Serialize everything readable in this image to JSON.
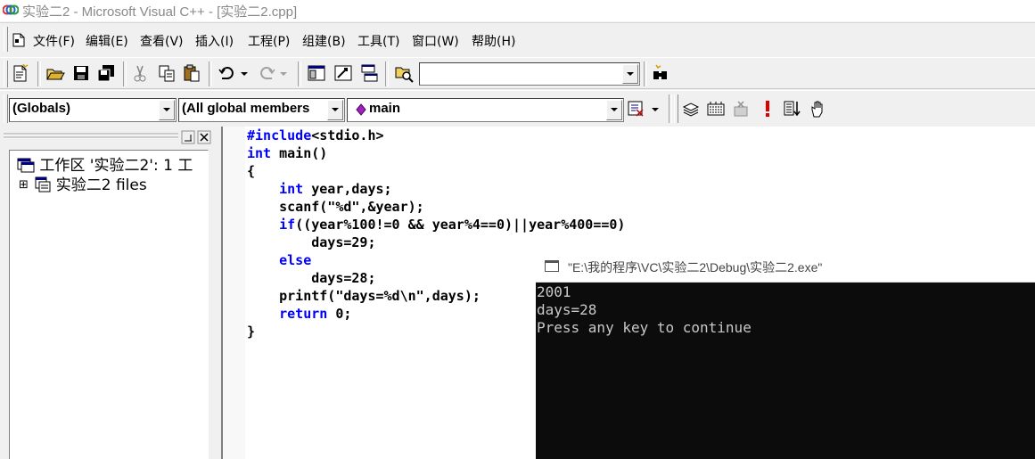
{
  "window": {
    "title": "实验二2 - Microsoft Visual C++ - [实验二2.cpp]"
  },
  "menu": {
    "items": [
      "文件(F)",
      "编辑(E)",
      "查看(V)",
      "插入(I)",
      "工程(P)",
      "组建(B)",
      "工具(T)",
      "窗口(W)",
      "帮助(H)"
    ]
  },
  "toolbar": {
    "find_combo_value": "",
    "globals_combo": "(Globals)",
    "members_combo": "(All global members",
    "function_combo": "main"
  },
  "workspace": {
    "root_label": "工作区 '实验二2': 1 工",
    "project_label": "实验二2 files",
    "expand_glyph": "⊞"
  },
  "editor": {
    "lines": [
      {
        "kw": "#include",
        "rest": "<stdio.h>"
      },
      {
        "kw": "int",
        "rest": " main()"
      },
      {
        "kw": "",
        "rest": "{"
      },
      {
        "kw": "    int",
        "rest": " year,days;"
      },
      {
        "kw": "",
        "rest": "    scanf(\"%d\",&year);"
      },
      {
        "kw": "    if",
        "rest": "((year%100!=0 && year%4==0)||year%400==0)"
      },
      {
        "kw": "",
        "rest": "        days=29;"
      },
      {
        "kw": "    else",
        "rest": ""
      },
      {
        "kw": "",
        "rest": "        days=28;"
      },
      {
        "kw": "",
        "rest": "    printf(\"days=%d\\n\",days);"
      },
      {
        "kw": "    return",
        "rest": " 0;"
      },
      {
        "kw": "",
        "rest": "}"
      }
    ]
  },
  "console": {
    "title": "\"E:\\我的程序\\VC\\实验二2\\Debug\\实验二2.exe\"",
    "output": [
      "2001",
      "days=28",
      "Press any key to continue"
    ]
  },
  "colors": {
    "keyword": "#0000ff",
    "console_bg": "#0c0c0c",
    "console_text": "#c8c8c8"
  }
}
